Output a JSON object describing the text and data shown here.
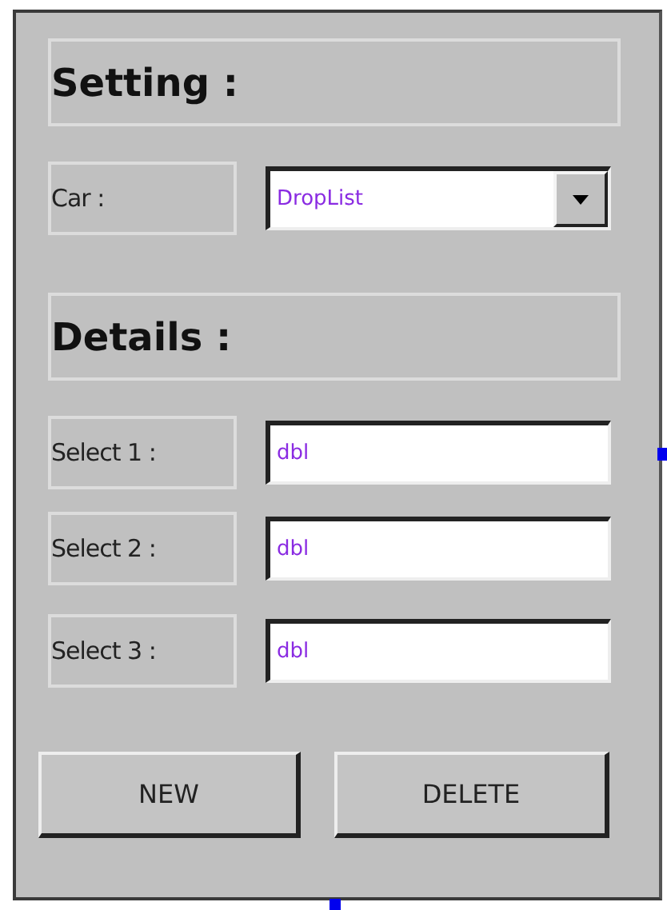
{
  "sections": [
    {
      "title": "Setting :",
      "rows": [
        {
          "kind": "dropdown",
          "label": "Car :",
          "value": "DropList"
        }
      ]
    },
    {
      "title": "Details :",
      "rows": [
        {
          "kind": "text",
          "label": "Select 1 :",
          "value": "dbl"
        },
        {
          "kind": "text",
          "label": "Select 2 :",
          "value": "dbl"
        },
        {
          "kind": "text",
          "label": "Select 3 :",
          "value": "dbl"
        }
      ]
    }
  ],
  "buttons": [
    "NEW",
    "DELETE"
  ]
}
